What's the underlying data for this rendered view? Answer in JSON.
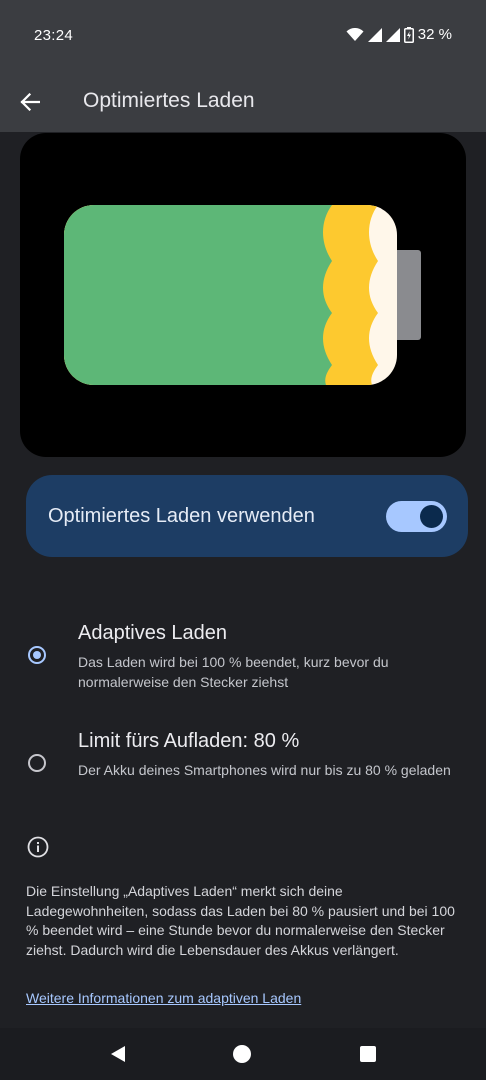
{
  "status_bar": {
    "time": "23:24",
    "battery_percent": "32 %",
    "icons": [
      "wifi-icon",
      "signal-icon",
      "signal-icon",
      "battery-charging-icon"
    ]
  },
  "app_bar": {
    "title": "Optimiertes Laden",
    "back_icon": "arrow-back-icon"
  },
  "battery_illustration": {
    "colors": {
      "green": "#5db777",
      "yellow": "#fdc92f",
      "cream": "#fff7ea",
      "terminal": "#8a8b8f"
    }
  },
  "toggle": {
    "label": "Optimiertes Laden verwenden",
    "checked": true
  },
  "options": [
    {
      "title": "Adaptives Laden",
      "description": "Das Laden wird bei 100 % beendet, kurz bevor du normalerweise den Stecker ziehst",
      "selected": true
    },
    {
      "title": "Limit fürs Aufladen: 80 %",
      "description": "Der Akku deines Smartphones wird nur bis zu 80 % geladen",
      "selected": false
    }
  ],
  "info": {
    "icon": "info-icon",
    "text": "Die Einstellung „Adaptives Laden“ merkt sich deine Ladegewohnheiten, sodass das Laden bei 80 % pausiert und bei 100 % beendet wird – eine Stunde bevor du normalerweise den Stecker ziehst. Dadurch wird die Lebensdauer des Akkus verlängert.",
    "link": "Weitere Informationen zum adaptiven Laden"
  },
  "nav_bar": {
    "icons": [
      "back-triangle-icon",
      "home-circle-icon",
      "recents-square-icon"
    ]
  },
  "colors": {
    "background": "#1f2024",
    "app_bar": "#3b3d41",
    "toggle_card": "#1d3d64",
    "accent": "#a7c8ff"
  }
}
